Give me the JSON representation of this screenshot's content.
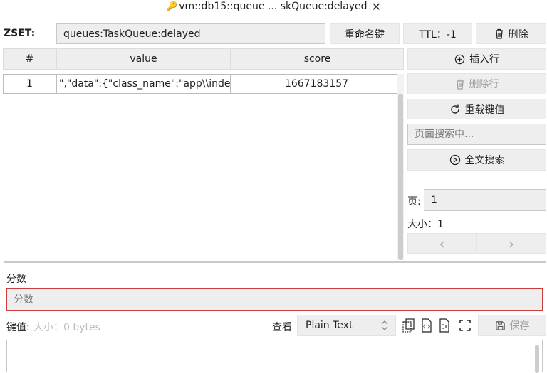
{
  "tab": {
    "title": "vm::db15::queue ... skQueue:delayed"
  },
  "header": {
    "type_label": "ZSET:",
    "key_name": "queues:TaskQueue:delayed",
    "rename_label": "重命名键",
    "ttl_label": "TTL：-1",
    "delete_label": "删除"
  },
  "table": {
    "columns": [
      "#",
      "value",
      "score"
    ],
    "rows": [
      {
        "index": "1",
        "value": "\",\"data\":{\"class_name\":\"app\\\\index\\\\c",
        "score": "1667183157"
      }
    ]
  },
  "side": {
    "insert_row": "插入行",
    "delete_row": "删除行",
    "reload": "重载键值",
    "search_placeholder": "页面搜索中...",
    "fulltext": "全文搜索",
    "page_label": "页:",
    "page_value": "1",
    "size_label": "大小：1",
    "prev": "‹",
    "next": "›"
  },
  "editor": {
    "score_label": "分数",
    "score_placeholder": "分数",
    "value_label": "键值:",
    "size_hint": "大小：0 bytes",
    "view_label": "查看",
    "format_value": "Plain Text",
    "save_label": "保存"
  },
  "colors": {
    "accent_key": "#f0a020",
    "error_border": "#cc3d3d",
    "button_bg": "#eeeeee"
  }
}
